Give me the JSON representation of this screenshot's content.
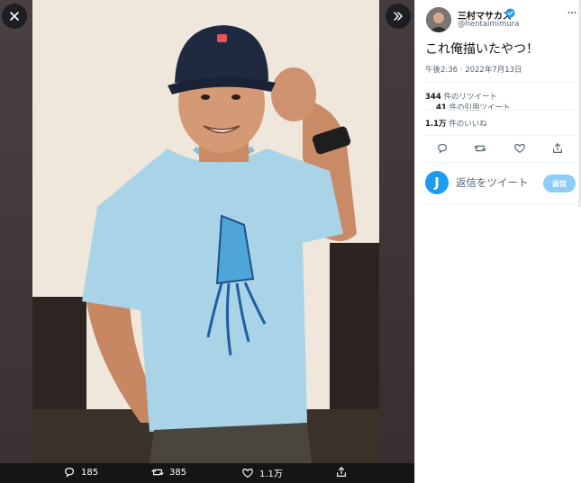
{
  "viewer": {
    "actions": {
      "reply_count": "185",
      "retweet_count": "385",
      "like_count": "1.1万"
    }
  },
  "tweet": {
    "author_name": "三村マサカズ",
    "author_handle": "@hentaimimura",
    "text": "これ俺描いたやつ！",
    "timestamp": "午後2:36 · 2022年7月13日",
    "retweets_count": "344",
    "retweets_label": " 件のリツイート",
    "quotes_count": "41",
    "quotes_label": " 件の引用ツイート",
    "likes_count": "1.1万",
    "likes_label": " 件のいいね"
  },
  "reply": {
    "avatar_letter": "J",
    "placeholder": "返信をツイート",
    "button_label": "返信"
  },
  "colors": {
    "accent": "#1d9bf0",
    "reply_button_disabled": "#8ecdf7",
    "viewer_background": "#3c3234",
    "secondary_text": "#536471"
  },
  "icons": {
    "close": "close-icon",
    "expand": "double-chevron-right-icon",
    "reply": "reply-icon",
    "retweet": "retweet-icon",
    "like": "heart-icon",
    "share": "share-icon",
    "more": "more-icon",
    "verified": "verified-badge-icon"
  }
}
